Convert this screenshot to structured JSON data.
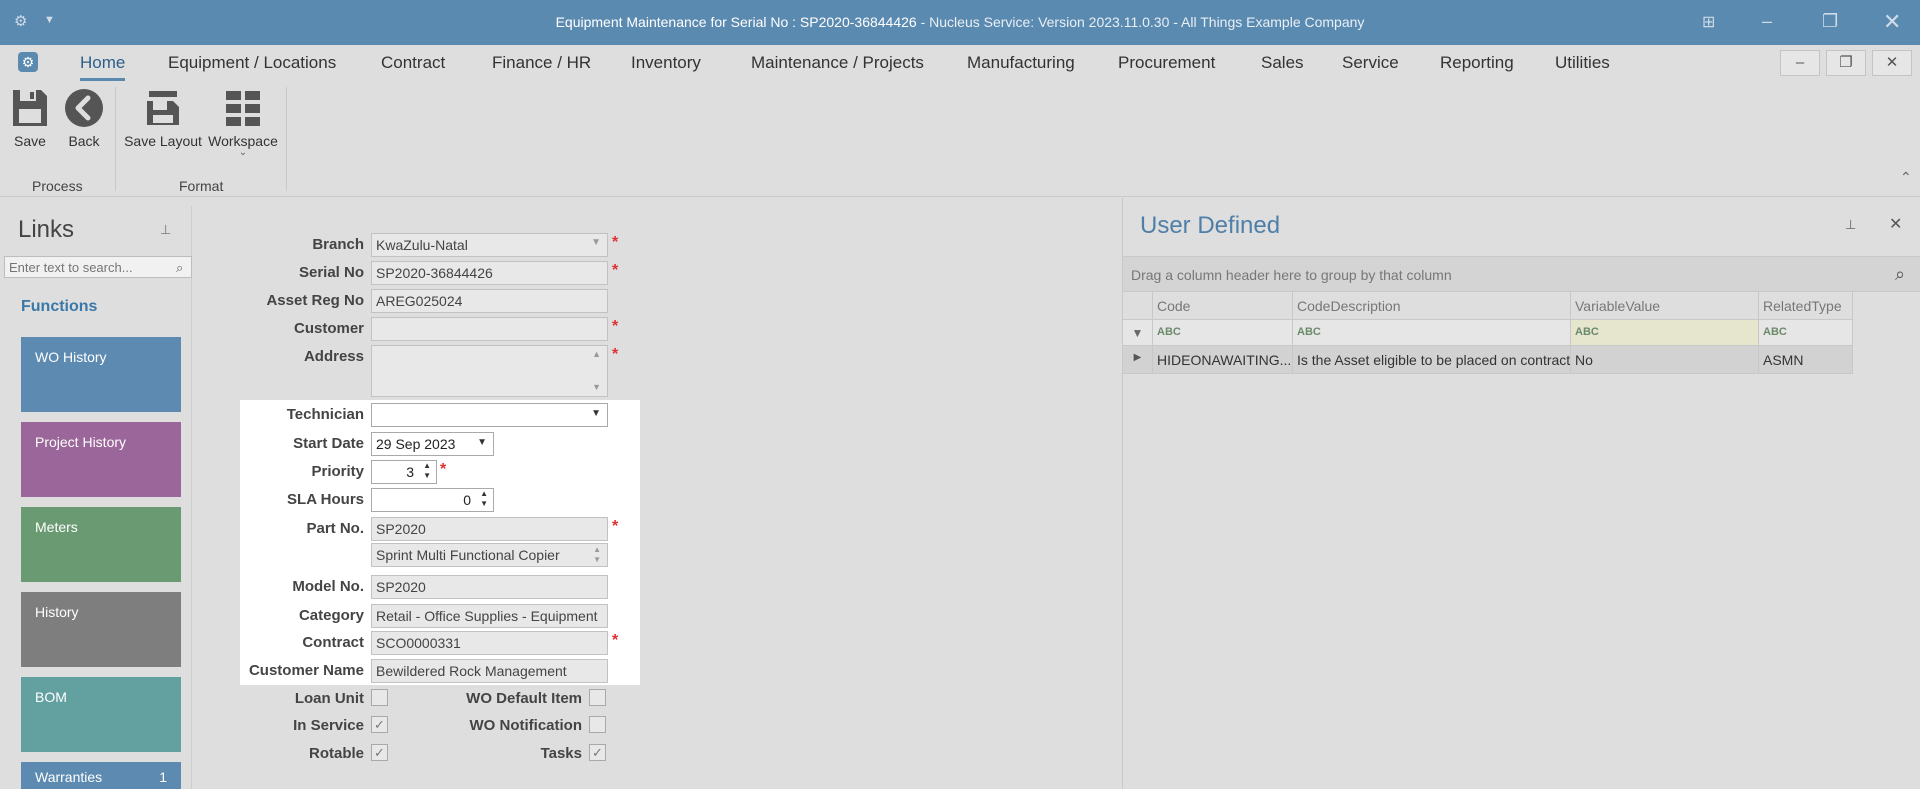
{
  "window": {
    "title_main": "Equipment Maintenance for Serial No : SP2020-36844426",
    "title_suffix": " - Nucleus Service: Version 2023.11.0.30 - All Things Example Company"
  },
  "menu": {
    "items": [
      "Home",
      "Equipment / Locations",
      "Contract",
      "Finance / HR",
      "Inventory",
      "Maintenance / Projects",
      "Manufacturing",
      "Procurement",
      "Sales",
      "Service",
      "Reporting",
      "Utilities"
    ],
    "active": "Home"
  },
  "ribbon": {
    "save": "Save",
    "back": "Back",
    "save_layout": "Save Layout",
    "workspace": "Workspace",
    "group_process": "Process",
    "group_format": "Format"
  },
  "links": {
    "title": "Links",
    "search_placeholder": "Enter text to search...",
    "functions_label": "Functions",
    "tiles": [
      {
        "label": "WO History",
        "color": "#5c8ab0"
      },
      {
        "label": "Project History",
        "color": "#9b6699"
      },
      {
        "label": "Meters",
        "color": "#6a9a72"
      },
      {
        "label": "History",
        "color": "#7e7e7e"
      },
      {
        "label": "BOM",
        "color": "#63a0a0"
      },
      {
        "label": "Warranties",
        "color": "#5c8ab0",
        "count": "1"
      }
    ]
  },
  "form": {
    "branch": {
      "label": "Branch",
      "value": "KwaZulu-Natal"
    },
    "serial_no": {
      "label": "Serial No",
      "value": "SP2020-36844426"
    },
    "asset_reg_no": {
      "label": "Asset Reg No",
      "value": "AREG025024"
    },
    "customer": {
      "label": "Customer",
      "value": ""
    },
    "address": {
      "label": "Address",
      "value": ""
    },
    "technician": {
      "label": "Technician",
      "value": ""
    },
    "start_date": {
      "label": "Start Date",
      "value": "29 Sep 2023"
    },
    "priority": {
      "label": "Priority",
      "value": "3"
    },
    "sla_hours": {
      "label": "SLA Hours",
      "value": "0"
    },
    "part_no": {
      "label": "Part No.",
      "value": "SP2020"
    },
    "part_description": "Sprint Multi Functional Copier",
    "model_no": {
      "label": "Model No.",
      "value": "SP2020"
    },
    "category": {
      "label": "Category",
      "value": "Retail - Office Supplies - Equipment"
    },
    "contract": {
      "label": "Contract",
      "value": "SCO0000331"
    },
    "customer_name": {
      "label": "Customer Name",
      "value": "Bewildered Rock Management"
    },
    "loan_unit": {
      "label": "Loan Unit",
      "checked": false
    },
    "in_service": {
      "label": "In Service",
      "checked": true
    },
    "rotable": {
      "label": "Rotable",
      "checked": true
    },
    "wo_default_item": {
      "label": "WO Default Item",
      "checked": false
    },
    "wo_notification": {
      "label": "WO Notification",
      "checked": false
    },
    "tasks": {
      "label": "Tasks",
      "checked": true
    },
    "required_mark": "*"
  },
  "user_defined": {
    "title": "User Defined",
    "group_hint": "Drag a column header here to group by that column",
    "columns": [
      "Code",
      "CodeDescription",
      "VariableValue",
      "RelatedType"
    ],
    "filter_glyph": "ABC",
    "rows": [
      {
        "code": "HIDEONAWAITING...",
        "description": "Is the Asset eligible to be placed on contract",
        "value": "No",
        "related_type": "ASMN"
      }
    ]
  }
}
